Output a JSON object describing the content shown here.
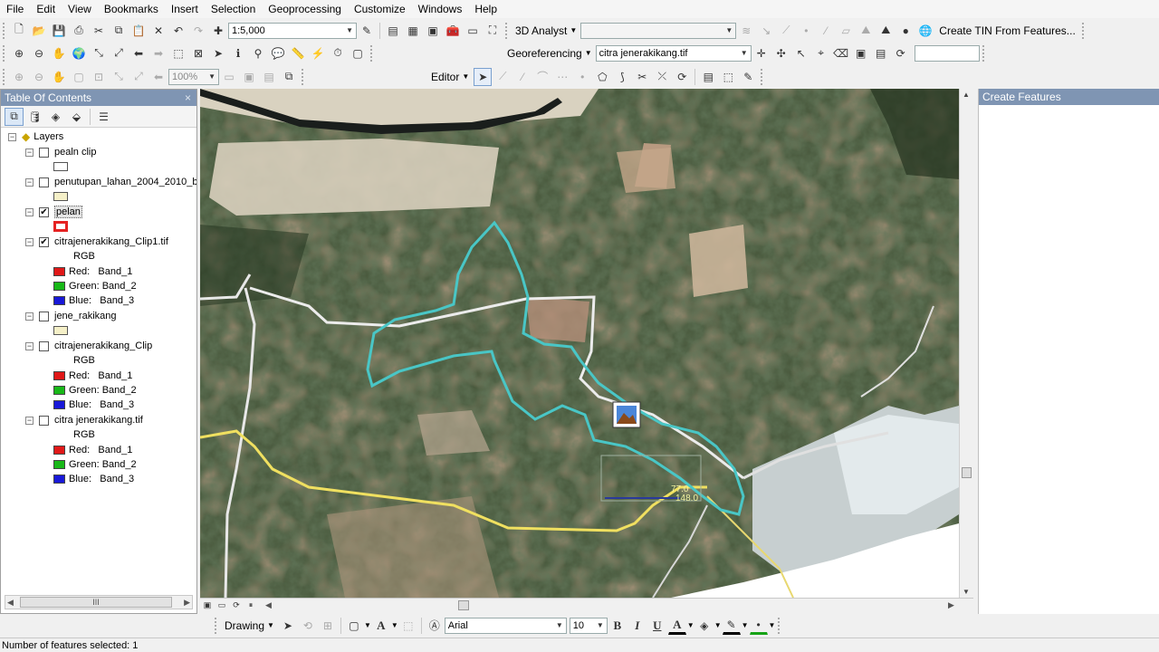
{
  "menu": [
    "File",
    "Edit",
    "View",
    "Bookmarks",
    "Insert",
    "Selection",
    "Geoprocessing",
    "Customize",
    "Windows",
    "Help"
  ],
  "toolbar": {
    "scale": "1:5,000",
    "analyst_3d": "3D Analyst",
    "create_tin": "Create TIN From Features...",
    "georeferencing": "Georeferencing",
    "georef_layer": "citra jenerakikang.tif",
    "zoom_percent": "100%",
    "editor": "Editor"
  },
  "toc": {
    "title": "Table Of Contents",
    "root": "Layers",
    "layers": [
      {
        "name": "pealn clip",
        "checked": false,
        "symbol": "#ffffff"
      },
      {
        "name": "penutupan_lahan_2004_2010_b",
        "checked": false,
        "symbol": "#f5f0c8"
      },
      {
        "name": "pelan",
        "checked": true,
        "symbol": "#e52222"
      },
      {
        "name": "citrajenerakikang_Clip1.tif",
        "checked": true,
        "rgb": "RGB",
        "bands": [
          {
            "label": "Red:",
            "band": "Band_1",
            "color": "#e01818"
          },
          {
            "label": "Green:",
            "band": "Band_2",
            "color": "#18b818"
          },
          {
            "label": "Blue:",
            "band": "Band_3",
            "color": "#1818d8"
          }
        ]
      },
      {
        "name": "jene_rakikang",
        "checked": false,
        "symbol": "#f5f0c8"
      },
      {
        "name": "citrajenerakikang_Clip",
        "checked": false,
        "rgb": "RGB",
        "bands": [
          {
            "label": "Red:",
            "band": "Band_1",
            "color": "#e01818"
          },
          {
            "label": "Green:",
            "band": "Band_2",
            "color": "#18b818"
          },
          {
            "label": "Blue:",
            "band": "Band_3",
            "color": "#1818d8"
          }
        ]
      },
      {
        "name": "citra jenerakikang.tif",
        "checked": false,
        "rgb": "RGB",
        "bands": [
          {
            "label": "Red:",
            "band": "Band_1",
            "color": "#e01818"
          },
          {
            "label": "Green:",
            "band": "Band_2",
            "color": "#18b818"
          },
          {
            "label": "Blue:",
            "band": "Band_3",
            "color": "#1818d8"
          }
        ]
      }
    ]
  },
  "create_features": {
    "title": "Create Features"
  },
  "drawing": {
    "drawing_label": "Drawing",
    "font": "Arial",
    "font_size": "10",
    "bold": "B",
    "italic": "I",
    "underline": "U",
    "text_tool": "A"
  },
  "map": {
    "polygon_color": "#49c6c6",
    "road_color": "#f0e060",
    "measure_labels": [
      "77.0",
      "148.0"
    ]
  },
  "status": {
    "text": "Number of features selected: 1"
  }
}
